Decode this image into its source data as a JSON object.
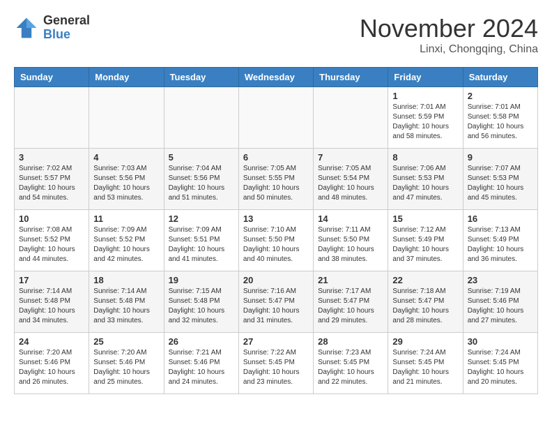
{
  "logo": {
    "general": "General",
    "blue": "Blue"
  },
  "title": "November 2024",
  "location": "Linxi, Chongqing, China",
  "days_of_week": [
    "Sunday",
    "Monday",
    "Tuesday",
    "Wednesday",
    "Thursday",
    "Friday",
    "Saturday"
  ],
  "weeks": [
    [
      {
        "day": "",
        "info": ""
      },
      {
        "day": "",
        "info": ""
      },
      {
        "day": "",
        "info": ""
      },
      {
        "day": "",
        "info": ""
      },
      {
        "day": "",
        "info": ""
      },
      {
        "day": "1",
        "info": "Sunrise: 7:01 AM\nSunset: 5:59 PM\nDaylight: 10 hours\nand 58 minutes."
      },
      {
        "day": "2",
        "info": "Sunrise: 7:01 AM\nSunset: 5:58 PM\nDaylight: 10 hours\nand 56 minutes."
      }
    ],
    [
      {
        "day": "3",
        "info": "Sunrise: 7:02 AM\nSunset: 5:57 PM\nDaylight: 10 hours\nand 54 minutes."
      },
      {
        "day": "4",
        "info": "Sunrise: 7:03 AM\nSunset: 5:56 PM\nDaylight: 10 hours\nand 53 minutes."
      },
      {
        "day": "5",
        "info": "Sunrise: 7:04 AM\nSunset: 5:56 PM\nDaylight: 10 hours\nand 51 minutes."
      },
      {
        "day": "6",
        "info": "Sunrise: 7:05 AM\nSunset: 5:55 PM\nDaylight: 10 hours\nand 50 minutes."
      },
      {
        "day": "7",
        "info": "Sunrise: 7:05 AM\nSunset: 5:54 PM\nDaylight: 10 hours\nand 48 minutes."
      },
      {
        "day": "8",
        "info": "Sunrise: 7:06 AM\nSunset: 5:53 PM\nDaylight: 10 hours\nand 47 minutes."
      },
      {
        "day": "9",
        "info": "Sunrise: 7:07 AM\nSunset: 5:53 PM\nDaylight: 10 hours\nand 45 minutes."
      }
    ],
    [
      {
        "day": "10",
        "info": "Sunrise: 7:08 AM\nSunset: 5:52 PM\nDaylight: 10 hours\nand 44 minutes."
      },
      {
        "day": "11",
        "info": "Sunrise: 7:09 AM\nSunset: 5:52 PM\nDaylight: 10 hours\nand 42 minutes."
      },
      {
        "day": "12",
        "info": "Sunrise: 7:09 AM\nSunset: 5:51 PM\nDaylight: 10 hours\nand 41 minutes."
      },
      {
        "day": "13",
        "info": "Sunrise: 7:10 AM\nSunset: 5:50 PM\nDaylight: 10 hours\nand 40 minutes."
      },
      {
        "day": "14",
        "info": "Sunrise: 7:11 AM\nSunset: 5:50 PM\nDaylight: 10 hours\nand 38 minutes."
      },
      {
        "day": "15",
        "info": "Sunrise: 7:12 AM\nSunset: 5:49 PM\nDaylight: 10 hours\nand 37 minutes."
      },
      {
        "day": "16",
        "info": "Sunrise: 7:13 AM\nSunset: 5:49 PM\nDaylight: 10 hours\nand 36 minutes."
      }
    ],
    [
      {
        "day": "17",
        "info": "Sunrise: 7:14 AM\nSunset: 5:48 PM\nDaylight: 10 hours\nand 34 minutes."
      },
      {
        "day": "18",
        "info": "Sunrise: 7:14 AM\nSunset: 5:48 PM\nDaylight: 10 hours\nand 33 minutes."
      },
      {
        "day": "19",
        "info": "Sunrise: 7:15 AM\nSunset: 5:48 PM\nDaylight: 10 hours\nand 32 minutes."
      },
      {
        "day": "20",
        "info": "Sunrise: 7:16 AM\nSunset: 5:47 PM\nDaylight: 10 hours\nand 31 minutes."
      },
      {
        "day": "21",
        "info": "Sunrise: 7:17 AM\nSunset: 5:47 PM\nDaylight: 10 hours\nand 29 minutes."
      },
      {
        "day": "22",
        "info": "Sunrise: 7:18 AM\nSunset: 5:47 PM\nDaylight: 10 hours\nand 28 minutes."
      },
      {
        "day": "23",
        "info": "Sunrise: 7:19 AM\nSunset: 5:46 PM\nDaylight: 10 hours\nand 27 minutes."
      }
    ],
    [
      {
        "day": "24",
        "info": "Sunrise: 7:20 AM\nSunset: 5:46 PM\nDaylight: 10 hours\nand 26 minutes."
      },
      {
        "day": "25",
        "info": "Sunrise: 7:20 AM\nSunset: 5:46 PM\nDaylight: 10 hours\nand 25 minutes."
      },
      {
        "day": "26",
        "info": "Sunrise: 7:21 AM\nSunset: 5:46 PM\nDaylight: 10 hours\nand 24 minutes."
      },
      {
        "day": "27",
        "info": "Sunrise: 7:22 AM\nSunset: 5:45 PM\nDaylight: 10 hours\nand 23 minutes."
      },
      {
        "day": "28",
        "info": "Sunrise: 7:23 AM\nSunset: 5:45 PM\nDaylight: 10 hours\nand 22 minutes."
      },
      {
        "day": "29",
        "info": "Sunrise: 7:24 AM\nSunset: 5:45 PM\nDaylight: 10 hours\nand 21 minutes."
      },
      {
        "day": "30",
        "info": "Sunrise: 7:24 AM\nSunset: 5:45 PM\nDaylight: 10 hours\nand 20 minutes."
      }
    ]
  ]
}
